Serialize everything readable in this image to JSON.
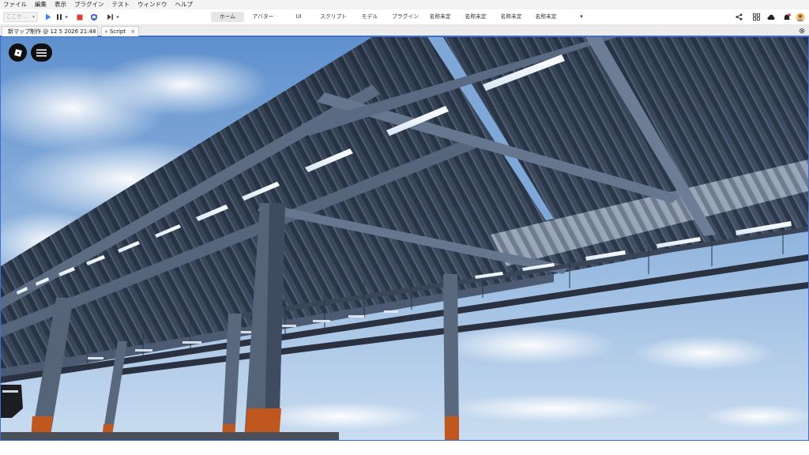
{
  "menu": {
    "items": [
      "ファイル",
      "編集",
      "表示",
      "プラグイン",
      "テスト",
      "ウィンドウ",
      "ヘルプ"
    ]
  },
  "toolbar": {
    "place_select_placeholder": "ここで ...",
    "ribbon_tabs": [
      {
        "label": "ホーム",
        "active": true
      },
      {
        "label": "アバター",
        "active": false
      },
      {
        "label": "UI",
        "active": false
      },
      {
        "label": "スクリプト",
        "active": false
      },
      {
        "label": "モデル",
        "active": false
      },
      {
        "label": "プラグイン",
        "active": false
      },
      {
        "label": "名称未定",
        "active": false
      },
      {
        "label": "名称未定",
        "active": false
      },
      {
        "label": "名称未定",
        "active": false
      },
      {
        "label": "名称未定",
        "active": false
      }
    ],
    "more_tabs_glyph": "▾"
  },
  "doc_tabs": [
    {
      "label": "新マップ制作 @ 12 5 2026 21:48",
      "close": "×"
    },
    {
      "label": "Script",
      "close": "×"
    }
  ],
  "colors": {
    "accent": "#3d6fd6",
    "play": "#3b82f6",
    "stop": "#e53935",
    "pillar_rust": "#c0571f",
    "steel": "#53627a"
  }
}
